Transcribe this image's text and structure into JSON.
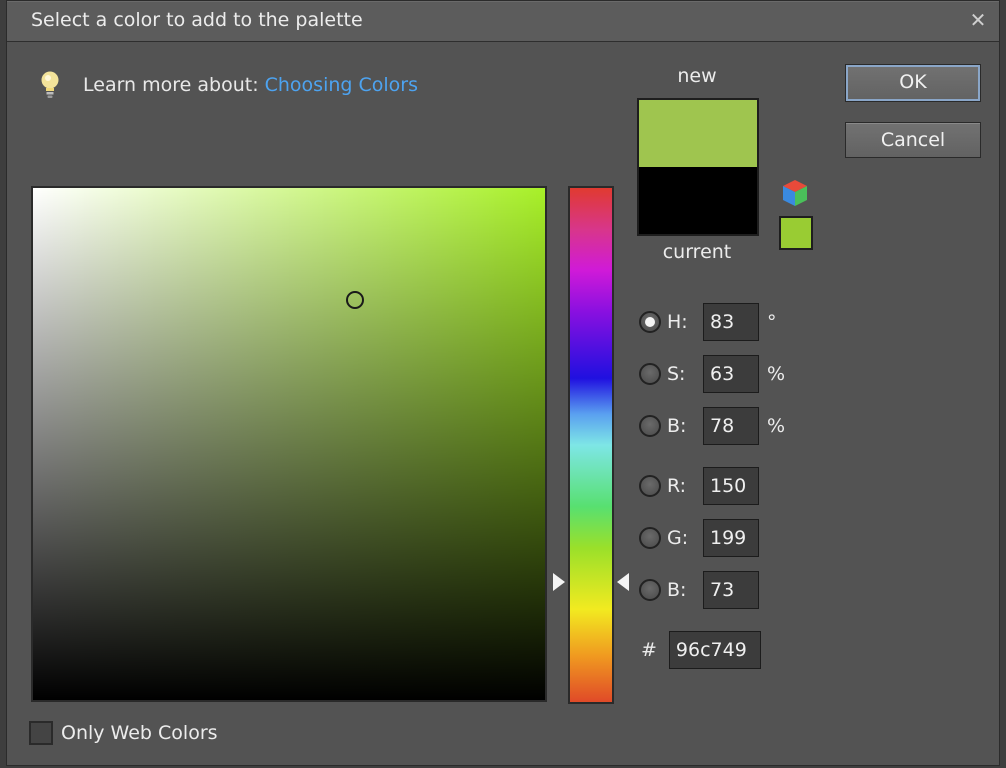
{
  "window": {
    "title": "Select a color to add to the palette",
    "close_icon": "close-icon"
  },
  "learn_more": {
    "prefix": "Learn more about:",
    "link": "Choosing Colors",
    "icon": "lightbulb-icon"
  },
  "preview": {
    "new_label": "new",
    "current_label": "current",
    "new_color": "#9fc54f",
    "current_color": "#000000",
    "web_safe_color": "#99cc33"
  },
  "buttons": {
    "ok": "OK",
    "cancel": "Cancel"
  },
  "fields": {
    "h": {
      "label": "H:",
      "value": "83",
      "unit": "°",
      "selected": true
    },
    "s": {
      "label": "S:",
      "value": "63",
      "unit": "%"
    },
    "b": {
      "label": "B:",
      "value": "78",
      "unit": "%"
    },
    "r": {
      "label": "R:",
      "value": "150"
    },
    "g": {
      "label": "G:",
      "value": "199"
    },
    "blue": {
      "label": "B:",
      "value": "73"
    },
    "hex": {
      "label": "#",
      "value": "96c749"
    }
  },
  "field_hue_color": "#a8f028",
  "web_only": {
    "label": "Only Web Colors",
    "checked": false
  }
}
